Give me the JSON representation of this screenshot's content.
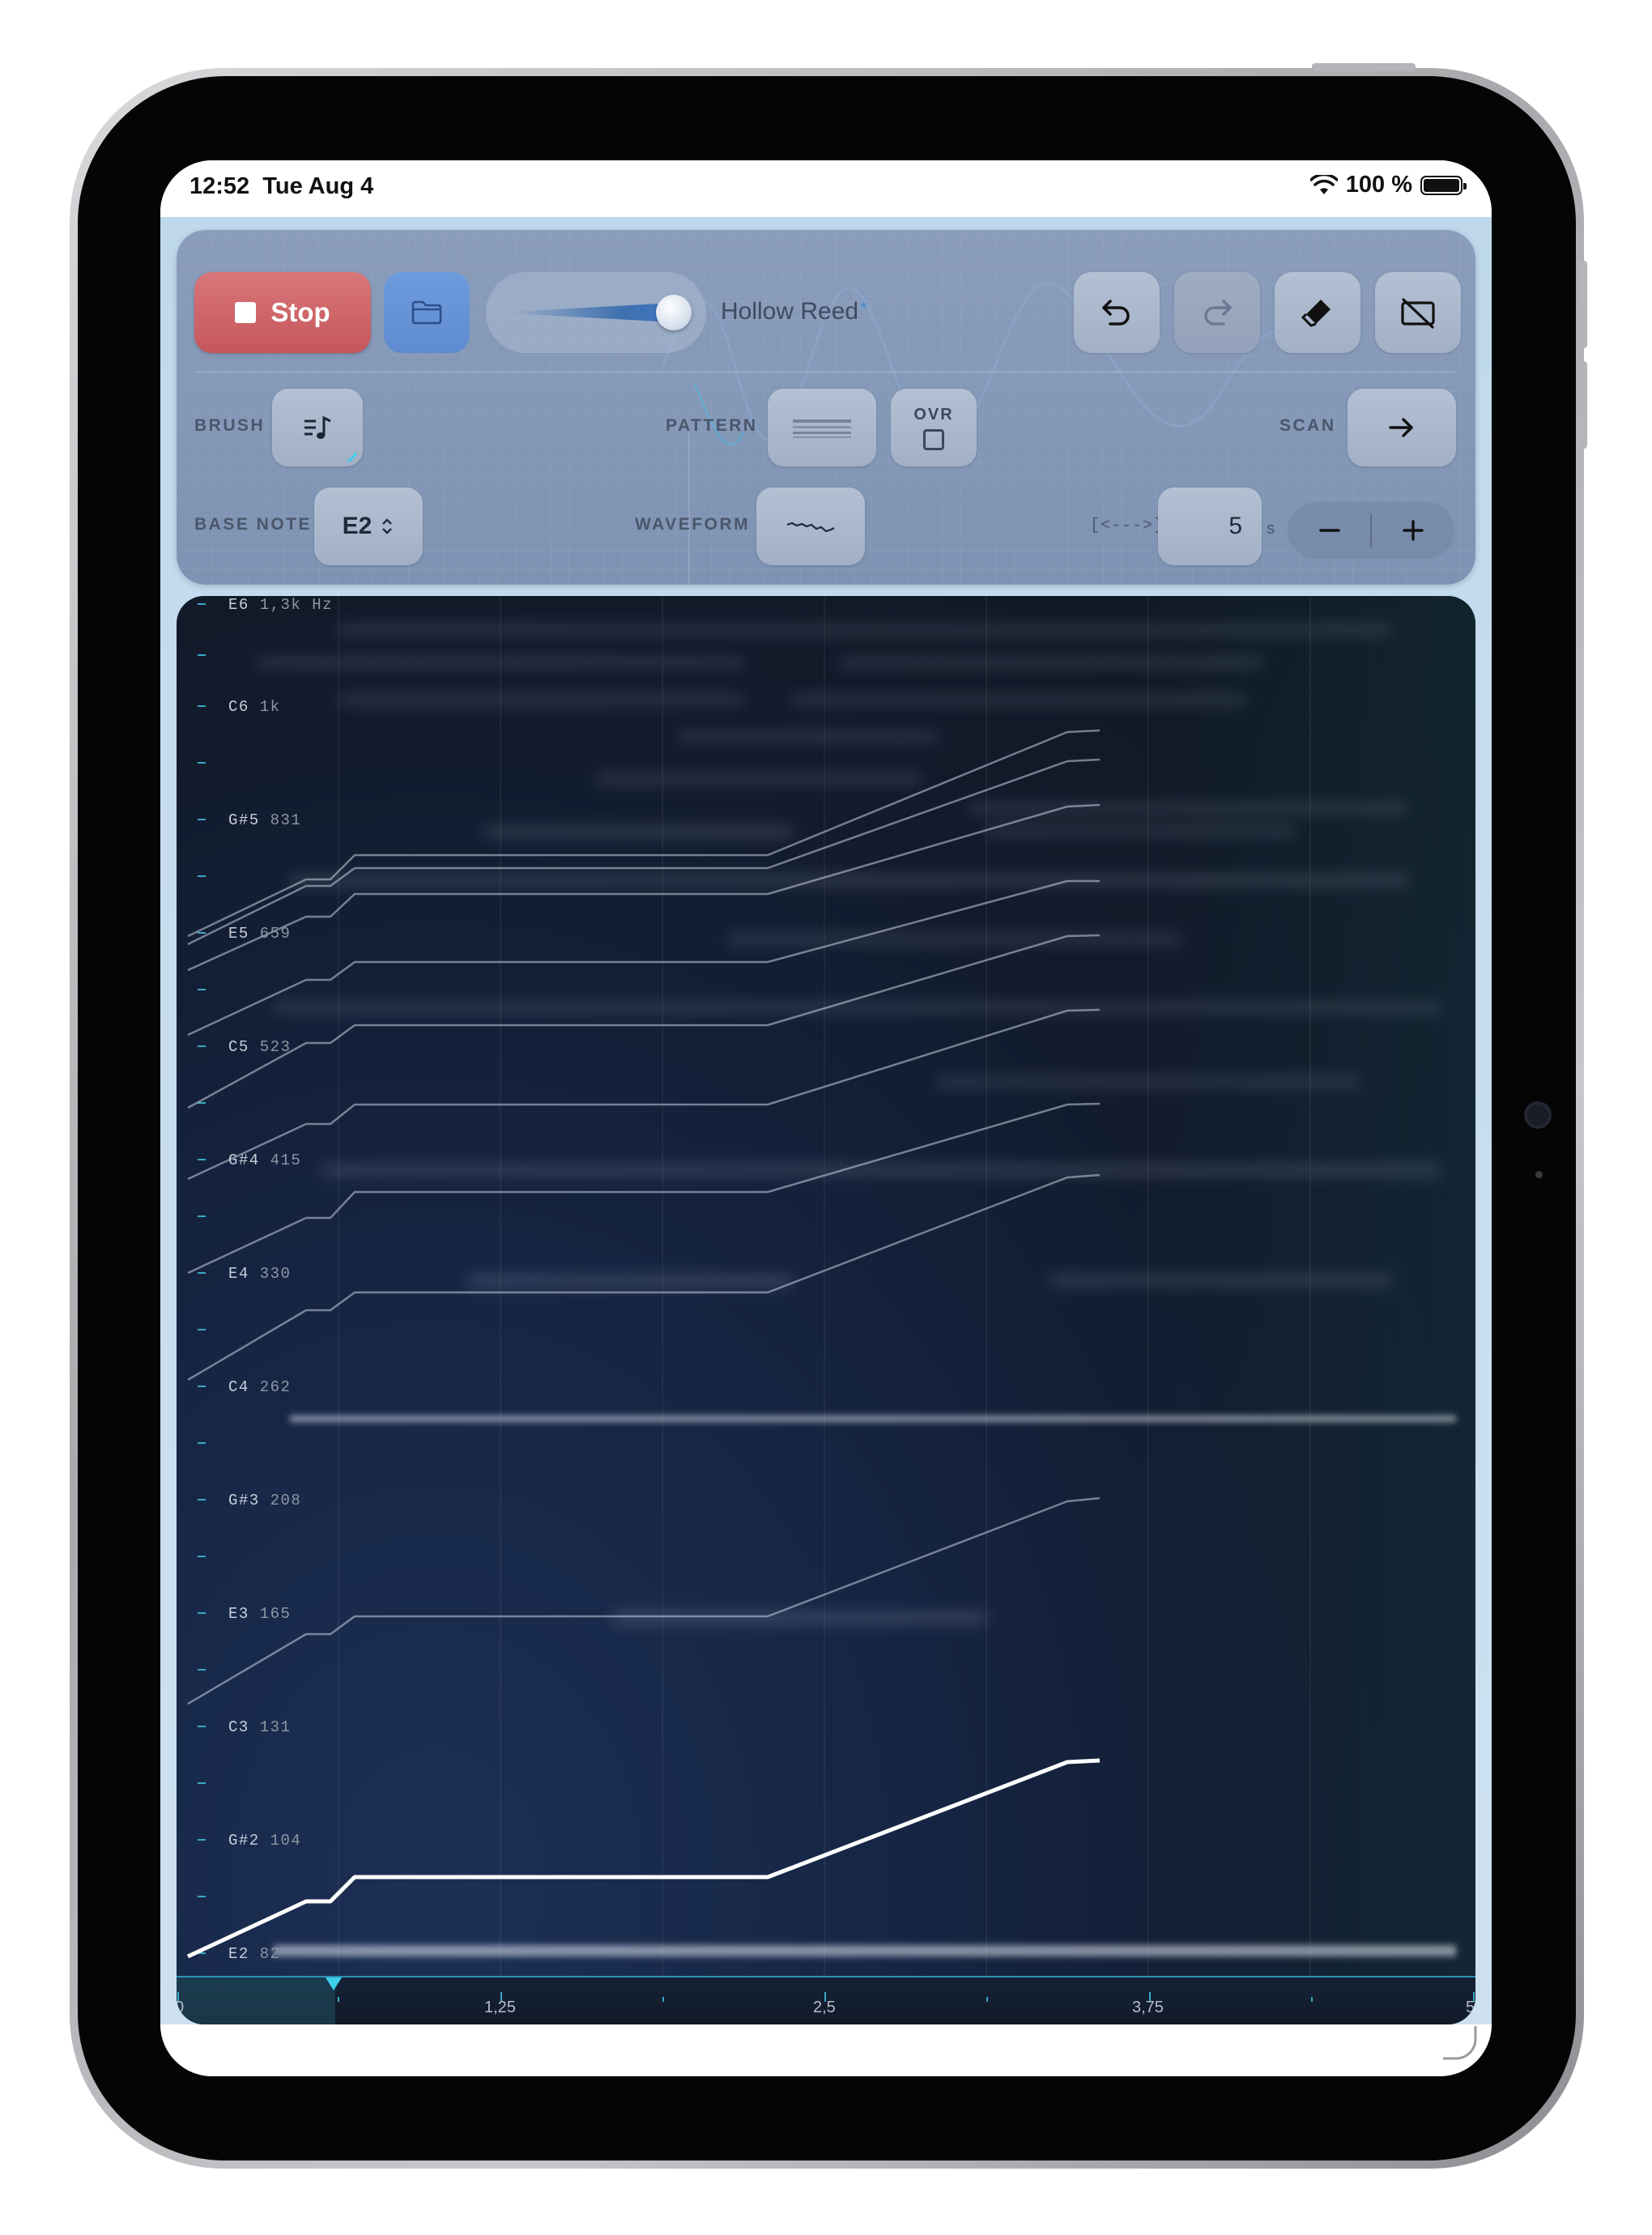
{
  "status_bar": {
    "time": "12:52",
    "date": "Tue Aug 4",
    "battery": "100 %"
  },
  "toolbar": {
    "stop_label": "Stop",
    "preset_name": "Hollow Reed",
    "preset_modified_marker": "*",
    "volume_level": 0.88
  },
  "controls": {
    "brush_label": "BRUSH",
    "pattern_label": "PATTERN",
    "ovr_label": "OVR",
    "scan_label": "SCAN",
    "base_note_label": "BASE NOTE",
    "base_note_value": "E2",
    "waveform_label": "WAVEFORM",
    "range_label": "[<--->]",
    "seconds_value": "5",
    "seconds_unit": "s"
  },
  "spectrogram": {
    "note_labels": [
      {
        "note": "E6",
        "hz": "1,3k Hz"
      },
      {
        "note": "C6",
        "hz": "1k"
      },
      {
        "note": "G#5",
        "hz": "831"
      },
      {
        "note": "E5",
        "hz": "659"
      },
      {
        "note": "C5",
        "hz": "523"
      },
      {
        "note": "G#4",
        "hz": "415"
      },
      {
        "note": "E4",
        "hz": "330"
      },
      {
        "note": "C4",
        "hz": "262"
      },
      {
        "note": "G#3",
        "hz": "208"
      },
      {
        "note": "E3",
        "hz": "165"
      },
      {
        "note": "C3",
        "hz": "131"
      },
      {
        "note": "G#2",
        "hz": "104"
      },
      {
        "note": "E2",
        "hz": "82"
      }
    ],
    "time_ticks": [
      "0",
      "1,25",
      "2,5",
      "3,75",
      "5"
    ],
    "playhead_time": 0.5,
    "accent_color": "#3ed0e8"
  }
}
